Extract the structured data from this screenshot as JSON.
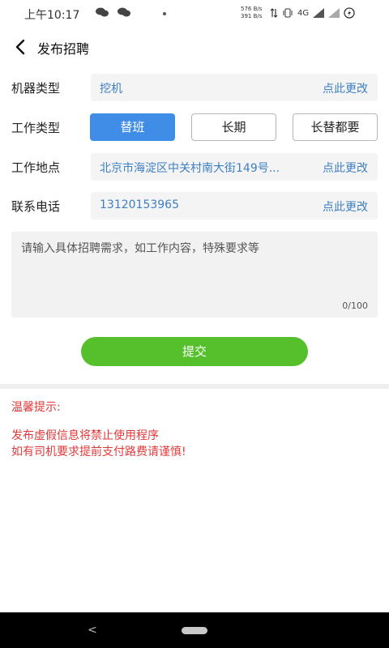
{
  "status_bar": {
    "time": "上午10:17",
    "speed_up": "576 B/s",
    "speed_down": "391 B/s",
    "network": "4G"
  },
  "header": {
    "title": "发布招聘"
  },
  "form": {
    "machine_type": {
      "label": "机器类型",
      "value": "挖机",
      "change": "点此更改"
    },
    "work_type": {
      "label": "工作类型",
      "options": [
        "替班",
        "长期",
        "长替都要"
      ],
      "selected": "替班"
    },
    "location": {
      "label": "工作地点",
      "value": "北京市海淀区中关村南大街149号...",
      "change": "点此更改"
    },
    "phone": {
      "label": "联系电话",
      "value": "13120153965",
      "change": "点此更改"
    },
    "requirements": {
      "placeholder": "请输入具体招聘需求，如工作内容，特殊要求等",
      "counter": "0/100"
    },
    "submit_label": "提交"
  },
  "tips": {
    "title": "温馨提示:",
    "lines": [
      "发布虚假信息将禁止使用程序",
      "如有司机要求提前支付路费请谨慎!"
    ]
  },
  "nav": {
    "back_glyph": "<"
  },
  "colors": {
    "accent": "#3f8de6",
    "link": "#3d7fc4",
    "submit": "#55c02b",
    "warning": "#e0393a"
  }
}
